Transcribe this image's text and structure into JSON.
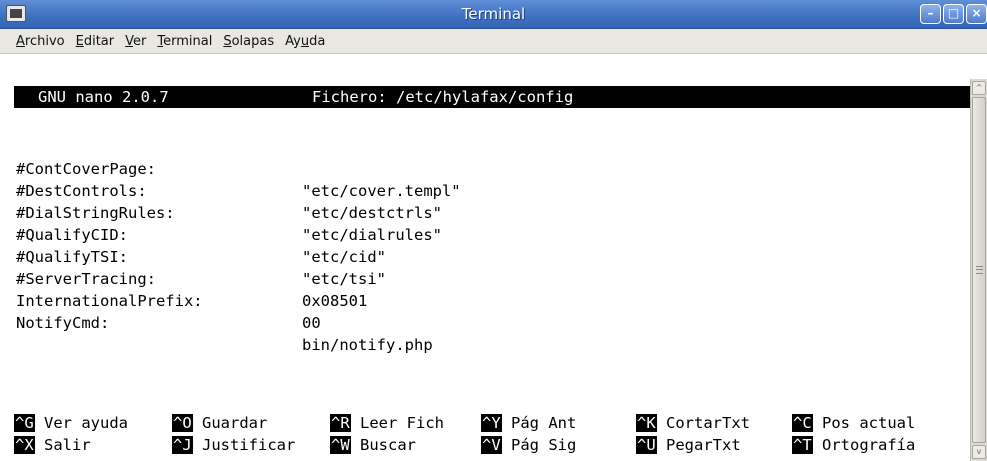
{
  "window": {
    "title": "Terminal",
    "buttons": {
      "minimize": "–",
      "maximize": "□",
      "close": "×"
    }
  },
  "menubar": [
    {
      "pre": "",
      "accel": "A",
      "post": "rchivo"
    },
    {
      "pre": "",
      "accel": "E",
      "post": "ditar"
    },
    {
      "pre": "",
      "accel": "V",
      "post": "er"
    },
    {
      "pre": "",
      "accel": "T",
      "post": "erminal"
    },
    {
      "pre": "",
      "accel": "S",
      "post": "olapas"
    },
    {
      "pre": "Ay",
      "accel": "u",
      "post": "da"
    }
  ],
  "nano": {
    "version": "GNU nano 2.0.7",
    "file_label": "Fichero: /etc/hylafax/config"
  },
  "config_lines": [
    {
      "key": "#ContCoverPage:",
      "value": "\"etc/cover.templ\""
    },
    {
      "key": "#DestControls:",
      "value": "\"etc/destctrls\""
    },
    {
      "key": "#DialStringRules:",
      "value": "\"etc/dialrules\""
    },
    {
      "key": "#QualifyCID:",
      "value": "\"etc/cid\""
    },
    {
      "key": "#QualifyTSI:",
      "value": "\"etc/tsi\""
    },
    {
      "key": "#ServerTracing:",
      "value": "0x08501"
    },
    {
      "key": "InternationalPrefix:",
      "value": "00"
    },
    {
      "key": "NotifyCmd:",
      "value": "bin/notify.php"
    }
  ],
  "shortcuts": {
    "row1": [
      {
        "key": "^G",
        "label": "Ver ayuda"
      },
      {
        "key": "^O",
        "label": "Guardar"
      },
      {
        "key": "^R",
        "label": "Leer Fich"
      },
      {
        "key": "^Y",
        "label": "Pág Ant"
      },
      {
        "key": "^K",
        "label": "CortarTxt"
      },
      {
        "key": "^C",
        "label": "Pos actual"
      }
    ],
    "row2": [
      {
        "key": "^X",
        "label": "Salir"
      },
      {
        "key": "^J",
        "label": "Justificar"
      },
      {
        "key": "^W",
        "label": "Buscar"
      },
      {
        "key": "^V",
        "label": "Pág Sig"
      },
      {
        "key": "^U",
        "label": "PegarTxt"
      },
      {
        "key": "^T",
        "label": "Ortografía"
      }
    ]
  },
  "scrollbar": {
    "up_glyph": "^",
    "down_glyph": "v",
    "grip_glyph": "≡"
  },
  "icons": {
    "window_icon": "terminal-icon",
    "minimize": "minimize-icon",
    "maximize": "maximize-icon",
    "close": "close-icon"
  },
  "colors": {
    "titlebar": "#4a7acb",
    "menubar": "#e9e7e2",
    "terminal_bg": "#ffffff",
    "terminal_fg": "#000000",
    "highlight_bg": "#000000",
    "highlight_fg": "#ffffff"
  }
}
